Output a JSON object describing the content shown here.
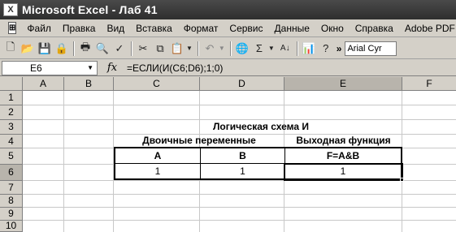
{
  "window": {
    "title": "Microsoft Excel - Лаб 41",
    "app_icon": "excel-icon"
  },
  "menu": {
    "items": [
      "Файл",
      "Правка",
      "Вид",
      "Вставка",
      "Формат",
      "Сервис",
      "Данные",
      "Окно",
      "Справка",
      "Adobe PDF"
    ]
  },
  "toolbar": {
    "icons": [
      "new-icon",
      "open-icon",
      "save-icon",
      "permission-icon",
      "print-preview-icon",
      "print-icon",
      "spelling-icon",
      "cut-icon",
      "copy-icon",
      "paste-icon",
      "undo-icon",
      "hyperlink-icon",
      "autosum-icon",
      "sort-ascending-icon",
      "chart-wizard-icon",
      "help-icon"
    ],
    "sigma": "Σ",
    "overflow": "»",
    "font_name": "Arial Cyr"
  },
  "formula_bar": {
    "name_box": "E6",
    "fx_label": "fx",
    "formula": "=ЕСЛИ(И(C6;D6);1;0)"
  },
  "sheet": {
    "columns": [
      "A",
      "B",
      "C",
      "D",
      "E",
      "F"
    ],
    "rows": [
      "1",
      "2",
      "3",
      "4",
      "5",
      "6",
      "7",
      "8",
      "9",
      "10"
    ],
    "active_cell": "E6",
    "title": "Логическая схема И",
    "header_left": "Двоичные переменные",
    "header_right": "Выходная функция",
    "col_a": "A",
    "col_b": "B",
    "col_f": "F=A&B",
    "val_a": "1",
    "val_b": "1",
    "val_f": "1"
  }
}
